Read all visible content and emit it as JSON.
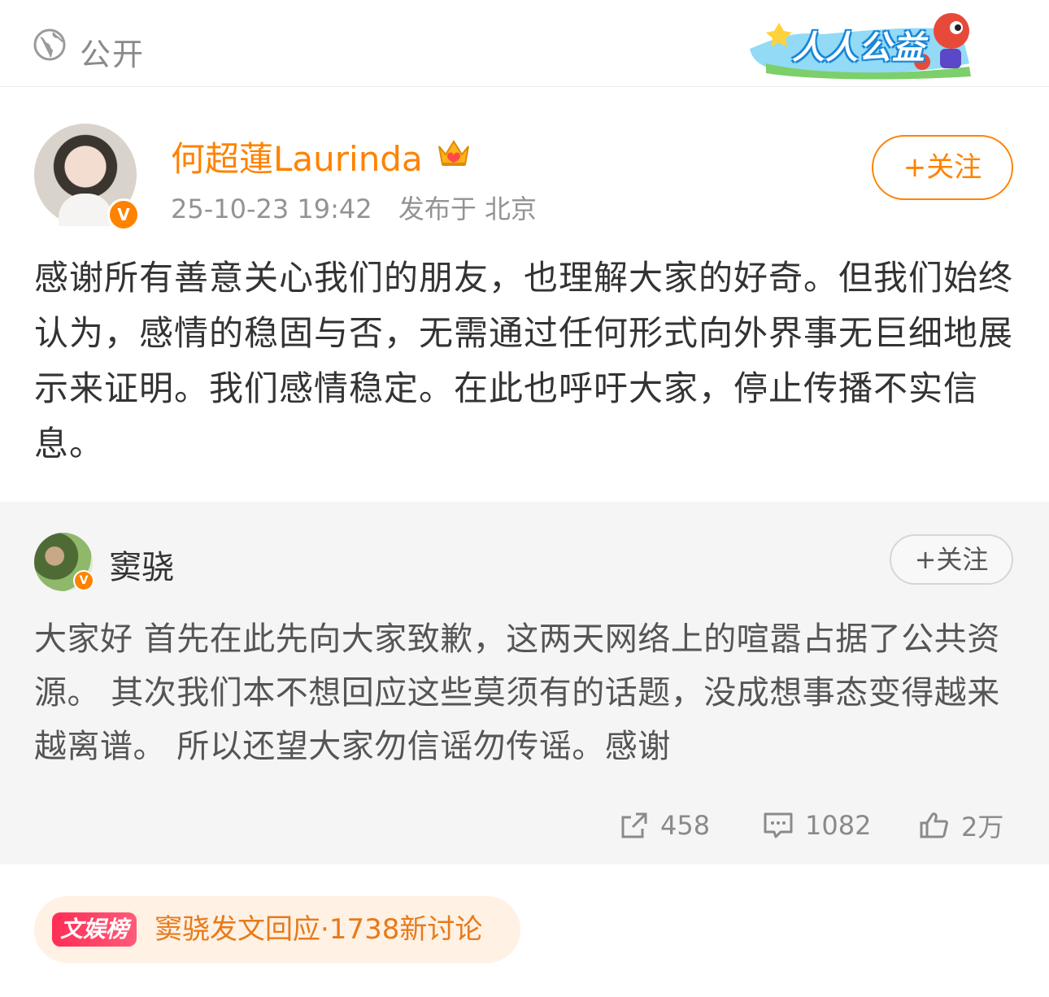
{
  "header": {
    "visibility": "公开",
    "charity_badge": "人人公益"
  },
  "post": {
    "author": "何超蓮Laurinda",
    "timestamp": "25-10-23 19:42",
    "location": "发布于 北京",
    "follow_label": "+关注",
    "text": "感谢所有善意关心我们的朋友，也理解大家的好奇。但我们始终认为，感情的稳固与否，无需通过任何形式向外界事无巨细地展示来证明。我们感情稳定。在此也呼吁大家，停止传播不实信息。",
    "verified_badge": "V"
  },
  "repost": {
    "author": "窦骁",
    "follow_label": "+关注",
    "verified_badge": "V",
    "text": "大家好 首先在此先向大家致歉，这两天网络上的喧嚣占据了公共资源。 其次我们本不想回应这些莫须有的话题，没成想事态变得越来越离谱。 所以还望大家勿信谣勿传谣。感谢",
    "stats": {
      "reposts": "458",
      "comments": "1082",
      "likes": "2万"
    }
  },
  "trending": {
    "tag": "文娱榜",
    "text": "窦骁发文回应·1738新讨论"
  },
  "colors": {
    "accent": "#ff8200",
    "trend_text": "#e87a1a",
    "trend_tag": "#ff2d55"
  },
  "icons": {
    "visibility": "globe-icon",
    "author_badge": "crown-icon",
    "repost": "share-icon",
    "comment": "comment-icon",
    "like": "thumbs-up-icon"
  }
}
